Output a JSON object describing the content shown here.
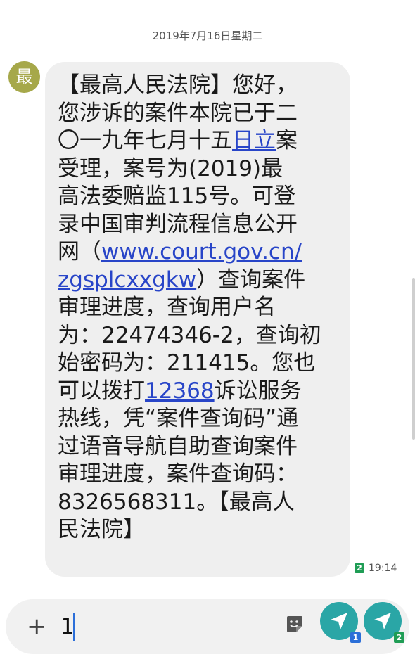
{
  "conversation": {
    "date": "2019年7月16日星期二",
    "avatar_letter": "最",
    "message_lines": [
      "【最高人民法院】您好，",
      "您涉诉的案件本院已于二",
      "〇一九年七月十五",
      "案",
      "受理，案号为(2019)最",
      "高法委赔监115号。可登",
      "录中国审判流程信息公开",
      "网（",
      "zgsplcxxgkw",
      "）查询案件",
      "审理进度，查询用户名",
      "为：22474346-2，查询初",
      "始密码为：211415。您也",
      "可以拨打",
      "诉讼服务",
      "热线，凭“案件查询码”通",
      "过语音导航自助查询案件",
      "审理进度，案件查询码：",
      "8326568311。【最高人",
      "民法院】"
    ],
    "link_date": "日立",
    "link_url": "www.court.gov.cn/",
    "link_phone": "12368",
    "sim_label": "2",
    "time": "19:14"
  },
  "composer": {
    "value": "1",
    "send_sim1_label": "1",
    "send_sim2_label": "2"
  },
  "colors": {
    "accent": "#2aa6a6",
    "link": "#2845c8",
    "avatar": "#a6a84a"
  }
}
